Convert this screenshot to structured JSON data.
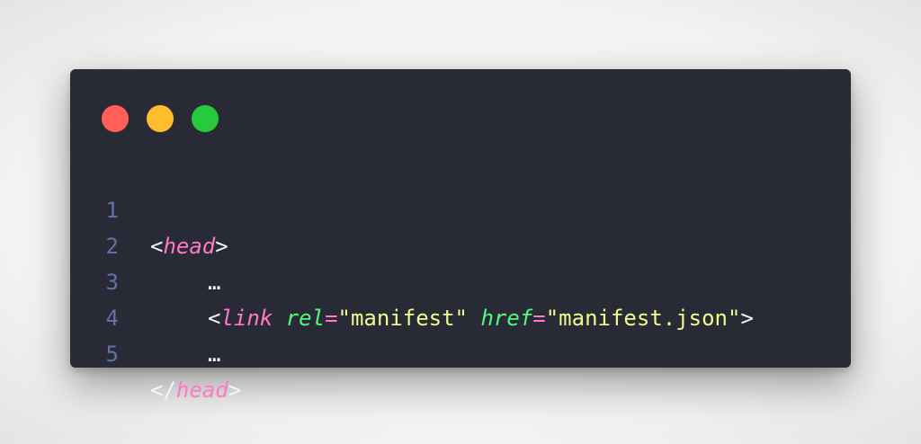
{
  "window": {
    "controls": [
      {
        "name": "close",
        "color": "#ff5f56"
      },
      {
        "name": "minimize",
        "color": "#ffbd2e"
      },
      {
        "name": "maximize",
        "color": "#27c93f"
      }
    ]
  },
  "code": {
    "language": "html",
    "lines": [
      {
        "number": "1",
        "open": "<",
        "tag": "head",
        "close": ">"
      },
      {
        "number": "2",
        "text": "…"
      },
      {
        "number": "3",
        "open": "<",
        "tag": "link",
        "attr1_name": "rel",
        "eq": "=",
        "attr1_value": "\"manifest\"",
        "attr2_name": "href",
        "attr2_value": "\"manifest.json\"",
        "close": ">"
      },
      {
        "number": "4",
        "text": "…"
      },
      {
        "number": "5",
        "open": "</",
        "tag": "head",
        "close": ">"
      }
    ]
  }
}
